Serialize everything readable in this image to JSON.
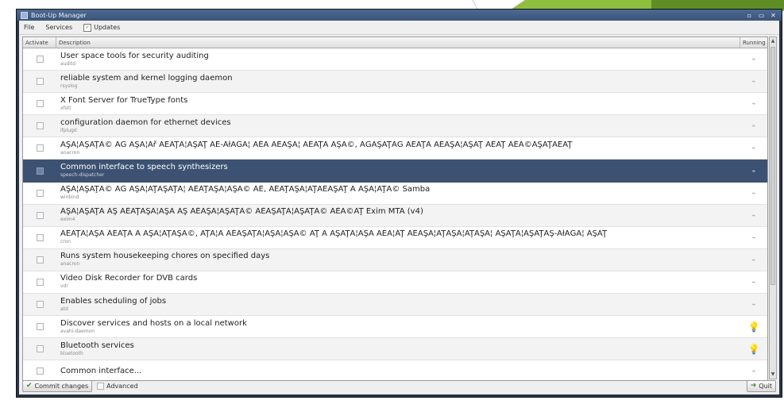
{
  "window": {
    "title": "Boot-Up Manager"
  },
  "titlebar_buttons": [
    "▫",
    "▭",
    "✕"
  ],
  "menu": [
    {
      "label": "File",
      "icon": ""
    },
    {
      "label": "Services",
      "icon": ""
    },
    {
      "label": "Updates",
      "icon": "✓"
    }
  ],
  "columns": {
    "activate": "Activate",
    "description": "Description",
    "running": "Running"
  },
  "services": [
    {
      "desc": "User space tools for security auditing",
      "name": "auditd",
      "running": false,
      "selected": false
    },
    {
      "desc": "reliable system and kernel logging daemon",
      "name": "rsyslog",
      "running": false,
      "selected": false
    },
    {
      "desc": "X Font Server for TrueType fonts",
      "name": "xfstt",
      "running": false,
      "selected": false
    },
    {
      "desc": "configuration daemon for ethernet devices",
      "name": "ifplugd",
      "running": false,
      "selected": false
    },
    {
      "desc": "ĂŞĂ¦ĂŞĂŢĂ© ĂĞ ĂŞĂ¦Ăř ĂĚĂŢĂ¦ĂŞĂŢ ĂĚ-ĂłĂĞĂ¦ ĂĚĂ ĂĚĂŞĂ¦ ĂĚĂŢĂ ĂŞĂ©, ĂĞĂŞĂŢĂĞ ĂĚĂŢĂ ĂĚĂŞĂ¦ĂŞĂŢ ĂĚĂŢ ĂĚĂ©ĂŞĂŢĂĚĂŢ",
      "name": "anacron",
      "running": false,
      "selected": false
    },
    {
      "desc": "Common interface to speech synthesizers",
      "name": "speech-dispatcher",
      "running": false,
      "selected": true
    },
    {
      "desc": "ĂŞĂ¦ĂŞĂŢĂ© ĂĞ ĂŞĂ¦ĂŢĂŞĂŢĂ¦ ĂĚĂŢĂŞĂ¦ĂŞĂ© ĂĚ, ĂĚĂŢĂŞĂ¦ĂŢĂĚĂŞĂŢ Ă ĂŞĂ¦ĂŢĂ© Samba",
      "name": "winbind",
      "running": false,
      "selected": false
    },
    {
      "desc": "ĂŞĂ¦ĂŞĂŢĂ ĂŞ ĂĚĂŢĂŞĂ¦ĂŞĂ ĂŞ ĂĚĂŞĂ¦ĂŞĂŢĂ© ĂĚĂŞĂŢĂ¦ĂŞĂŢĂ© ĂĚĂ©ĂŢ Exim MTA (v4)",
      "name": "exim4",
      "running": false,
      "selected": false
    },
    {
      "desc": "ĂĚĂŢĂ¦ĂŞĂ ĂĚĂŢĂ Ă ĂŞĂ¦ĂŢĂŞĂ©, ĂŢĂ¦Ă ĂĚĂŞĂŢĂ¦ĂŞĂ¦ĂŞĂ© ĂŢ Ă ĂŞĂŢĂ¦ĂŞĂ ĂĚĂ¦ĂŢ ĂĚĂŞĂ¦ĂŢĂŞĂ¦ĂŢĂŞĂ¦ ĂŞĂŢĂ¦ĂŞĂŢĂŞ-ĂłĂĞĂ¦ ĂŞĂŢ",
      "name": "cron",
      "running": false,
      "selected": false
    },
    {
      "desc": "Runs system housekeeping chores on specified days",
      "name": "anacron",
      "running": false,
      "selected": false
    },
    {
      "desc": "Video Disk Recorder for DVB cards",
      "name": "vdr",
      "running": false,
      "selected": false
    },
    {
      "desc": "Enables scheduling of jobs",
      "name": "atd",
      "running": false,
      "selected": false
    },
    {
      "desc": "Discover services and hosts on a local network",
      "name": "avahi-daemon",
      "running": true,
      "selected": false
    },
    {
      "desc": "Bluetooth services",
      "name": "bluetooth",
      "running": true,
      "selected": false
    },
    {
      "desc": "Common interface...",
      "name": "",
      "running": false,
      "selected": false
    }
  ],
  "bottom": {
    "commit_label": "Commit changes",
    "advanced_label": "Advanced",
    "quit_label": "Quit"
  }
}
